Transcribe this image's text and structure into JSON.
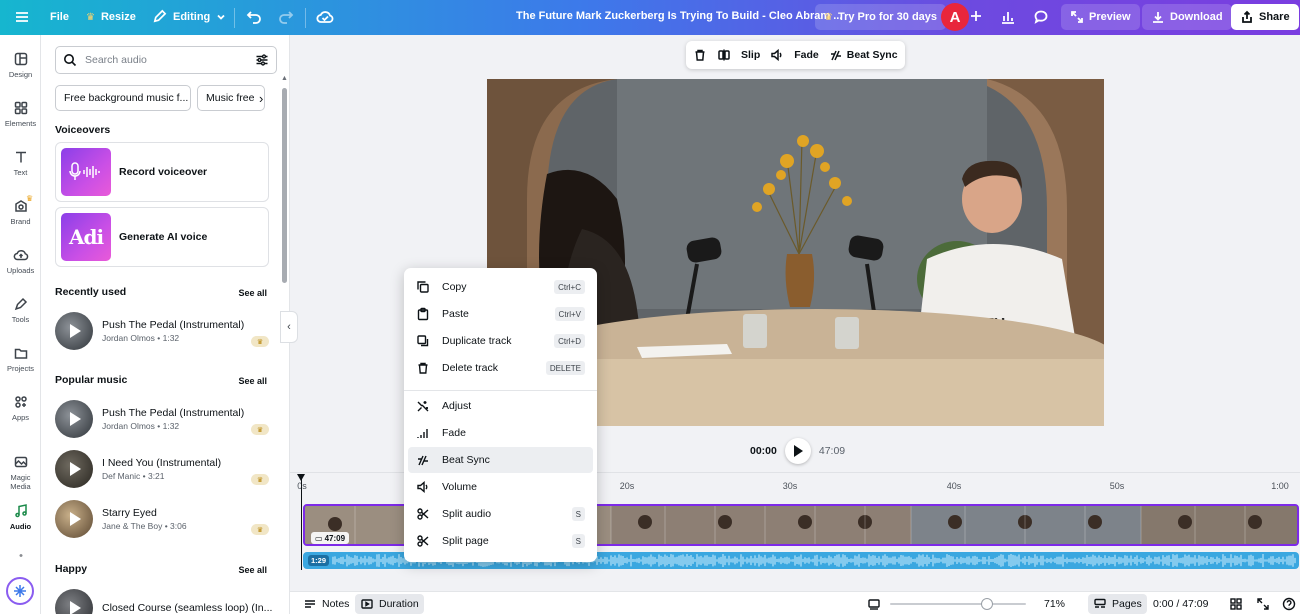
{
  "colors": {
    "accent": "#7d2ae8",
    "avatar": "#e8263c",
    "audio": "#3aa7e0"
  },
  "topbar": {
    "menu_icon": "hamburger-icon",
    "file": "File",
    "resize": "Resize",
    "editing": "Editing",
    "title": "The Future Mark Zuckerberg Is Trying To Build - Cleo Abram ...",
    "try_pro": "Try Pro for 30 days",
    "avatar_letter": "A",
    "preview": "Preview",
    "download": "Download",
    "share": "Share"
  },
  "rail": [
    {
      "label": "Design",
      "icon": "layout-icon"
    },
    {
      "label": "Elements",
      "icon": "shapes-icon"
    },
    {
      "label": "Text",
      "icon": "text-icon"
    },
    {
      "label": "Brand",
      "icon": "brand-icon"
    },
    {
      "label": "Uploads",
      "icon": "cloud-upload-icon"
    },
    {
      "label": "Tools",
      "icon": "pen-icon"
    },
    {
      "label": "Projects",
      "icon": "folder-icon"
    },
    {
      "label": "Apps",
      "icon": "apps-icon"
    },
    {
      "label": "Magic Media",
      "icon": "magic-media-icon"
    },
    {
      "label": "Audio",
      "icon": "music-note-icon"
    }
  ],
  "panel": {
    "search_placeholder": "Search audio",
    "chips": [
      "Free background music f...",
      "Music free"
    ],
    "voiceovers_heading": "Voiceovers",
    "record_voiceover": "Record voiceover",
    "generate_ai_voice": "Generate AI voice",
    "ai_thumb_text": "Adi",
    "see_all": "See all",
    "recently_used_heading": "Recently used",
    "recently_used": [
      {
        "title": "Push The Pedal (Instrumental)",
        "meta": "Jordan Olmos • 1:32"
      }
    ],
    "popular_heading": "Popular music",
    "popular": [
      {
        "title": "Push The Pedal (Instrumental)",
        "meta": "Jordan Olmos • 1:32"
      },
      {
        "title": "I Need You (Instrumental)",
        "meta": "Def Manic • 3:21"
      },
      {
        "title": "Starry Eyed",
        "meta": "Jane & The Boy • 3:06"
      }
    ],
    "happy_heading": "Happy",
    "happy": [
      {
        "title": "Closed Course (seamless loop) (In...",
        "meta": ""
      }
    ]
  },
  "float_toolbar": {
    "slip": "Slip",
    "fade": "Fade",
    "beat_sync": "Beat Sync"
  },
  "player": {
    "current": "00:00",
    "total": "47:09"
  },
  "ruler": [
    "0s",
    "20s",
    "30s",
    "40s",
    "50s",
    "1:00"
  ],
  "clip": {
    "duration": "47:09"
  },
  "audio_clip": {
    "duration": "1:29"
  },
  "context_menu": [
    {
      "label": "Copy",
      "shortcut": "Ctrl+C",
      "icon": "copy-icon"
    },
    {
      "label": "Paste",
      "shortcut": "Ctrl+V",
      "icon": "paste-icon"
    },
    {
      "label": "Duplicate track",
      "shortcut": "Ctrl+D",
      "icon": "duplicate-icon"
    },
    {
      "label": "Delete track",
      "shortcut": "DELETE",
      "icon": "trash-icon"
    },
    {
      "label": "Adjust",
      "shortcut": "",
      "icon": "adjust-icon"
    },
    {
      "label": "Fade",
      "shortcut": "",
      "icon": "fade-icon"
    },
    {
      "label": "Beat Sync",
      "shortcut": "",
      "icon": "beat-sync-icon"
    },
    {
      "label": "Volume",
      "shortcut": "",
      "icon": "volume-icon"
    },
    {
      "label": "Split audio",
      "shortcut": "S",
      "icon": "split-audio-icon"
    },
    {
      "label": "Split page",
      "shortcut": "S",
      "icon": "split-page-icon"
    }
  ],
  "bottombar": {
    "notes": "Notes",
    "duration": "Duration",
    "zoom": "71%",
    "zoom_level": 0.71,
    "pages": "Pages",
    "time": "0:00 / 47:09"
  }
}
